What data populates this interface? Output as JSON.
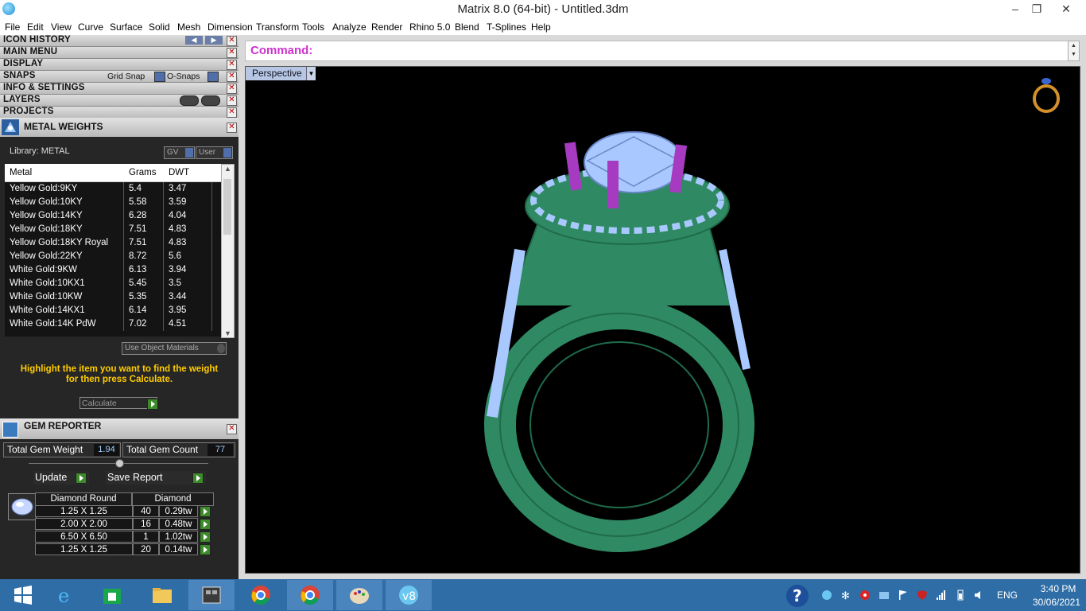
{
  "window": {
    "title": "Matrix 8.0 (64-bit) - Untitled.3dm",
    "minimize_glyph": "–",
    "restore_glyph": "❐",
    "close_glyph": "✕"
  },
  "menu": [
    "File",
    "Edit",
    "View",
    "Curve",
    "Surface",
    "Solid",
    "Mesh",
    "Dimension",
    "Transform",
    "Tools",
    "Analyze",
    "Render",
    "Rhino 5.0",
    "Blend",
    "T-Splines",
    "Help"
  ],
  "panel_sections": {
    "icon_history": "ICON HISTORY",
    "main_menu": "MAIN MENU",
    "display": "DISPLAY",
    "snaps": "SNAPS",
    "grid_snap": "Grid Snap",
    "o_snaps": "O-Snaps",
    "info_settings": "INFO & SETTINGS",
    "layers": "LAYERS",
    "projects": "PROJECTS"
  },
  "metal_weights": {
    "title": "METAL WEIGHTS",
    "library_label": "Library: METAL",
    "gv_label": "GV",
    "user_label": "User",
    "columns": [
      "Metal",
      "Grams",
      "DWT"
    ],
    "rows": [
      {
        "metal": "Yellow Gold:9KY",
        "grams": "5.4",
        "dwt": "3.47"
      },
      {
        "metal": "Yellow Gold:10KY",
        "grams": "5.58",
        "dwt": "3.59"
      },
      {
        "metal": "Yellow Gold:14KY",
        "grams": "6.28",
        "dwt": "4.04"
      },
      {
        "metal": "Yellow Gold:18KY",
        "grams": "7.51",
        "dwt": "4.83"
      },
      {
        "metal": "Yellow Gold:18KY Royal",
        "grams": "7.51",
        "dwt": "4.83"
      },
      {
        "metal": "Yellow Gold:22KY",
        "grams": "8.72",
        "dwt": "5.6"
      },
      {
        "metal": "White Gold:9KW",
        "grams": "6.13",
        "dwt": "3.94"
      },
      {
        "metal": "White Gold:10KX1",
        "grams": "5.45",
        "dwt": "3.5"
      },
      {
        "metal": "White Gold:10KW",
        "grams": "5.35",
        "dwt": "3.44"
      },
      {
        "metal": "White Gold:14KX1",
        "grams": "6.14",
        "dwt": "3.95"
      },
      {
        "metal": "White Gold:14K PdW",
        "grams": "7.02",
        "dwt": "4.51"
      }
    ],
    "use_object_materials": "Use Object Materials",
    "hint_line1": "Highlight the item you want to find the weight",
    "hint_line2": "for then press Calculate.",
    "calculate": "Calculate"
  },
  "gem_reporter": {
    "title": "GEM REPORTER",
    "total_weight_label": "Total Gem Weight",
    "total_weight_value": "1.94",
    "total_count_label": "Total Gem Count",
    "total_count_value": "77",
    "update": "Update",
    "save_report": "Save Report",
    "head_shape": "Diamond Round",
    "head_material": "Diamond",
    "rows": [
      {
        "size": "1.25 X 1.25",
        "count": "40",
        "weight": "0.29tw"
      },
      {
        "size": "2.00 X 2.00",
        "count": "16",
        "weight": "0.48tw"
      },
      {
        "size": "6.50 X 6.50",
        "count": "1",
        "weight": "1.02tw"
      },
      {
        "size": "1.25 X 1.25",
        "count": "20",
        "weight": "0.14tw"
      }
    ]
  },
  "command": {
    "label": "Command:"
  },
  "viewport": {
    "name": "Perspective"
  },
  "colors": {
    "metal": "#2f8a63",
    "gem": "#a9c8ff",
    "prong": "#a63ac0",
    "command": "#cc33cc",
    "hint": "#ffcc00",
    "taskbar": "#2e6da6"
  },
  "taskbar": {
    "apps": [
      "windows-start",
      "internet-explorer",
      "store",
      "file-explorer",
      "matrix-app",
      "chrome",
      "chrome-2",
      "paint",
      "vectorworks"
    ],
    "language": "ENG",
    "time": "3:40 PM",
    "date": "30/06/2021"
  }
}
